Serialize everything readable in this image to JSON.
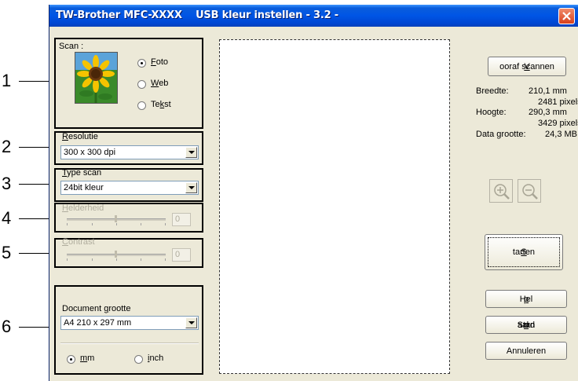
{
  "window": {
    "title": "TW-Brother MFC-XXXX    USB kleur instellen - 3.2 -"
  },
  "callouts": [
    "1",
    "2",
    "3",
    "4",
    "5",
    "6"
  ],
  "scan": {
    "label": "Scan :",
    "options": [
      {
        "pre": "",
        "u": "F",
        "post": "oto",
        "selected": true
      },
      {
        "pre": "",
        "u": "W",
        "post": "eb",
        "selected": false
      },
      {
        "pre": "Te",
        "u": "k",
        "post": "st",
        "selected": false
      }
    ]
  },
  "resolution": {
    "label_u": "R",
    "label_rest": "esolutie",
    "value": "300 x 300 dpi"
  },
  "scan_type": {
    "label_u": "T",
    "label_rest": "ype scan",
    "value": "24bit kleur"
  },
  "brightness": {
    "label_u": "H",
    "label_rest": "elderheid",
    "value": "0"
  },
  "contrast": {
    "label_u": "C",
    "label_rest": "ontrast",
    "value": "0"
  },
  "doc_size": {
    "label_pre": "Document ",
    "label_u": "g",
    "label_post": "rootte",
    "value": "A4 210 x 297 mm",
    "unit_mm": {
      "u": "m",
      "rest": "m",
      "selected": true
    },
    "unit_inch": {
      "u": "i",
      "rest": "nch",
      "selected": false
    }
  },
  "right_panel": {
    "prescan_u": "V",
    "prescan_rest": "ooraf scannen",
    "width_label": "Breedte:",
    "width_mm": "210,1 mm",
    "width_px": "2481 pixels",
    "height_label": "Hoogte:",
    "height_mm": "290,3 mm",
    "height_px": "3429 pixels",
    "datasize_label": "Data grootte:",
    "datasize_value": "24,3 MB",
    "start_u": "S",
    "start_rest": "tarten",
    "help_pre": "Hel",
    "help_u": "p",
    "help_post": "",
    "default_pre": "Stan",
    "default_u": "d",
    "default_post": "aard",
    "cancel_label": "Annuleren"
  },
  "icons": [
    "close-icon",
    "sunflower-photo",
    "zoom-in-icon",
    "zoom-out-icon"
  ],
  "colors": {
    "titlebar": "#0055e5",
    "dialog_bg": "#ece9d8",
    "close": "#d8401c"
  }
}
